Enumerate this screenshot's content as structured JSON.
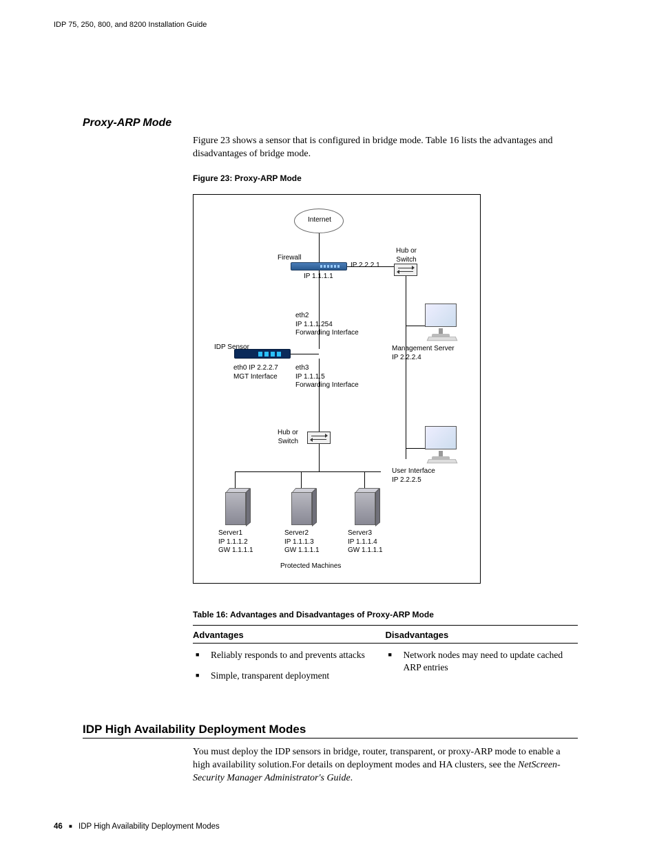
{
  "header": {
    "doc_title": "IDP 75, 250, 800, and 8200 Installation Guide"
  },
  "section": {
    "title": "Proxy-ARP Mode",
    "intro": "Figure 23 shows a sensor that is configured in bridge mode. Table 16 lists the advantages and disadvantages of bridge mode."
  },
  "figure": {
    "caption": "Figure 23:  Proxy-ARP Mode",
    "labels": {
      "internet": "Internet",
      "firewall": "Firewall",
      "ip_top_right": "IP 2.2.2.1",
      "hub_or_switch_top": "Hub or\nSwitch",
      "ip_below_fw": "IP 1.1.1.1",
      "eth2_block": "eth2\nIP 1.1.1.254\nForwarding Interface",
      "idp_sensor": "IDP Sensor",
      "mgmt_server": "Management Server\nIP 2.2.2.4",
      "eth0_block": "eth0 IP 2.2.2.7\nMGT Interface",
      "eth3_block": "eth3\nIP 1.1.1.5\nForwarding Interface",
      "hub_or_switch_mid": "Hub or\nSwitch",
      "user_interface": "User Interface\nIP 2.2.2.5",
      "server1": "Server1\nIP 1.1.1.2\nGW 1.1.1.1",
      "server2": "Server2\nIP 1.1.1.3\nGW 1.1.1.1",
      "server3": "Server3\nIP 1.1.1.4\nGW 1.1.1.1",
      "protected": "Protected Machines"
    }
  },
  "table": {
    "caption": "Table 16:  Advantages and Disadvantages of Proxy-ARP Mode",
    "headers": {
      "adv": "Advantages",
      "dis": "Disadvantages"
    },
    "advantages": [
      "Reliably responds to and prevents attacks",
      "Simple, transparent deployment"
    ],
    "disadvantages": [
      "Network nodes may need to update cached ARP entries"
    ]
  },
  "section2": {
    "title": "IDP High Availability Deployment Modes",
    "body_pre": "You must deploy the IDP sensors in bridge, router, transparent, or proxy-ARP mode to enable a high availability solution.For details on deployment modes and HA clusters, see the ",
    "body_em": "NetScreen-Security Manager Administrator's Guide",
    "body_post": "."
  },
  "footer": {
    "page": "46",
    "label": "IDP High Availability Deployment Modes"
  }
}
